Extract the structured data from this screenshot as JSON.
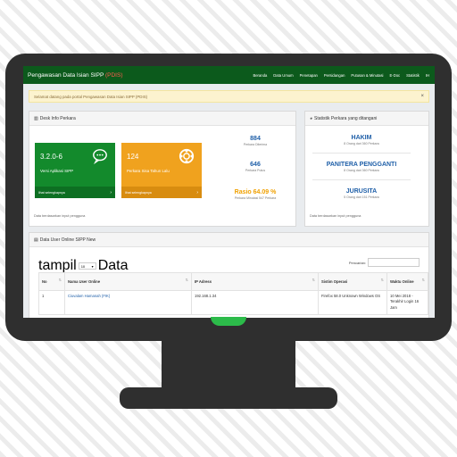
{
  "app": {
    "brand": "Pengawasan Data Isian SIPP",
    "brand_accent": "(PDIS)"
  },
  "nav": {
    "items": [
      "Beranda",
      "Data Umum",
      "Penetapan",
      "Persidangan",
      "Putusan & Minutasi",
      "E-Doc",
      "Statistik",
      "IH"
    ]
  },
  "alert": {
    "text": "Selamat datang pada portal Pengawasan Data Isian SIPP (PDIS)",
    "close": "×"
  },
  "info_panel": {
    "title": "Desk Info Perkara",
    "tile_version": {
      "value": "3.2.0-6",
      "label": "Versi Aplikasi SIPP",
      "link": "lihat selengkapnya",
      "arrow": "›"
    },
    "tile_pending": {
      "value": "124",
      "label": "Perkara Sisa Tahun Lalu",
      "link": "lihat selengkapnya",
      "arrow": "›"
    },
    "stat_1": {
      "value": "884",
      "caption": "Perkara Diterima"
    },
    "stat_2": {
      "value": "646",
      "caption": "Perkara Putus"
    },
    "ratio": {
      "value": "Rasio 64.09 %",
      "caption": "Perkara Minutasi 547 Perkara"
    },
    "footer": "Data berdasarkan input pengguna"
  },
  "stats_panel": {
    "title": "Statistik Perkara yang ditangani",
    "hakim": {
      "title": "HAKIM",
      "caption": "8 Orang dari 360 Perkara"
    },
    "panitera": {
      "title": "PANITERA PENGGANTI",
      "caption": "8 Orang dari 360 Perkara"
    },
    "jurusita": {
      "title": "JURUSITA",
      "caption": "5 Orang dari 151 Perkara"
    },
    "footer": "Data berdasarkan input pengguna"
  },
  "users_panel": {
    "title": "Data User Online SIPP New",
    "show_prefix": "tampil",
    "page_size": "10",
    "show_suffix": "Data",
    "search_label": "Pencarian:",
    "columns": [
      "No",
      "Nama User Online",
      "IP Adress",
      "Sistim Operasi",
      "Waktu Online"
    ],
    "rows": [
      {
        "no": "1",
        "name": "Ciuvalam Hamanah (FIK)",
        "ip": "192.168.1.34",
        "os": "Firefox 58.0 Unknown Windows OS",
        "time": "10 Mei 2018 - Terakhir Login 16 Jam"
      }
    ]
  },
  "colors": {
    "navbar": "#0c5a1c",
    "tile_green": "#138a2c",
    "tile_orange": "#f0a21e",
    "stat_blue": "#1f5fa8",
    "monitor": "#2f2f2f"
  }
}
